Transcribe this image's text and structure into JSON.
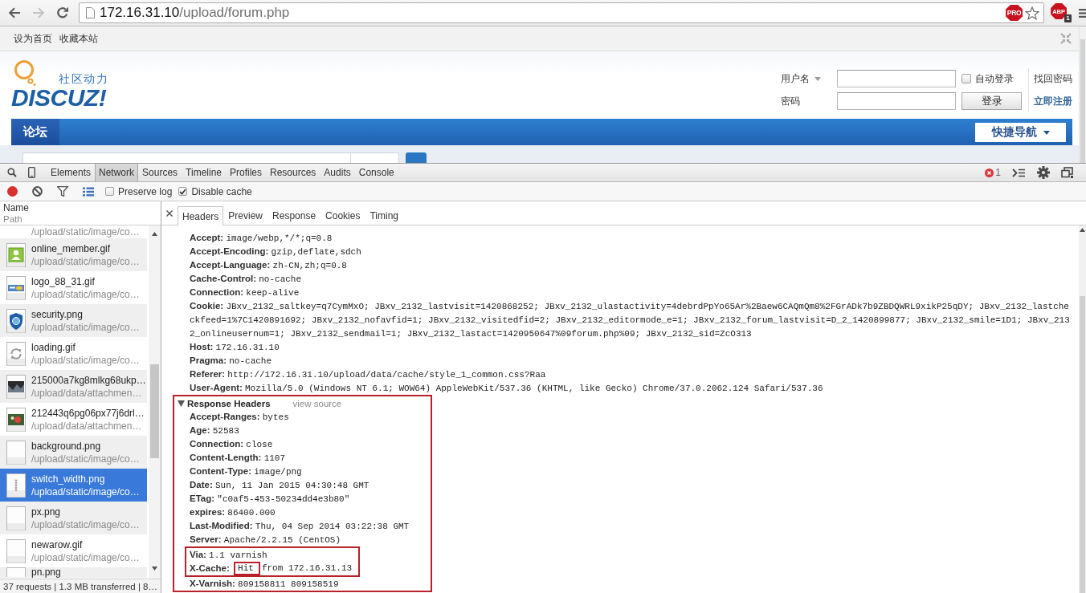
{
  "toolbar": {
    "back": {
      "disabled": false
    },
    "forward": {
      "disabled": true
    }
  },
  "address_bar": {
    "host": "172.16.31.10",
    "path": "/upload/forum.php",
    "badge": "PRO"
  },
  "extension": {
    "label": "ABP",
    "badge": "1"
  },
  "site": {
    "top_links": [
      "设为首页",
      "收藏本站"
    ],
    "logo": {
      "tagline": "社区动力",
      "wordmark": "DISCUZ!"
    },
    "login": {
      "username_label": "用户名",
      "password_label": "密码",
      "remember": {
        "label": "自动登录",
        "checked": false
      },
      "forgot_link": "找回密码",
      "submit": "登录",
      "register_link": "立即注册"
    },
    "nav": {
      "items": [
        {
          "label": "论坛",
          "selected": true
        }
      ],
      "quick_nav": "快捷导航"
    }
  },
  "devtools": {
    "panels": [
      {
        "label": "Elements",
        "selected": false
      },
      {
        "label": "Network",
        "selected": true
      },
      {
        "label": "Sources",
        "selected": false
      },
      {
        "label": "Timeline",
        "selected": false
      },
      {
        "label": "Profiles",
        "selected": false
      },
      {
        "label": "Resources",
        "selected": false
      },
      {
        "label": "Audits",
        "selected": false
      },
      {
        "label": "Console",
        "selected": false
      }
    ],
    "error_count": "1",
    "network": {
      "recording": true,
      "preserve_log": {
        "label": "Preserve log",
        "checked": false
      },
      "disable_cache": {
        "label": "Disable cache",
        "checked": true
      },
      "column": {
        "title": "Name",
        "subtitle": "Path"
      },
      "requests": [
        {
          "path": "/upload/static/image/co…",
          "selected": false
        },
        {
          "kind": "person",
          "name": "online_member.gif",
          "path": "/upload/static/image/co…",
          "selected": false
        },
        {
          "kind": "banner",
          "name": "logo_88_31.gif",
          "path": "/upload/static/image/co…",
          "selected": false
        },
        {
          "kind": "shield",
          "name": "security.png",
          "path": "/upload/static/image/co…",
          "selected": false
        },
        {
          "kind": "refresh",
          "name": "loading.gif",
          "path": "/upload/static/image/co…",
          "selected": false
        },
        {
          "kind": "photo",
          "name": "215000a7kg8mlkg68ukp…",
          "path": "/upload/data/attachmen…",
          "selected": false
        },
        {
          "kind": "picture",
          "name": "212443q6pg06px77j6drl…",
          "path": "/upload/data/attachmen…",
          "selected": false
        },
        {
          "kind": "blank",
          "name": "background.png",
          "path": "/upload/static/image/co…",
          "selected": false
        },
        {
          "kind": "grip",
          "name": "switch_width.png",
          "path": "/upload/static/image/co…",
          "selected": true
        },
        {
          "kind": "blank",
          "name": "px.png",
          "path": "/upload/static/image/co…",
          "selected": false
        },
        {
          "kind": "blank",
          "name": "newarow.gif",
          "path": "/upload/static/image/co…",
          "selected": false
        },
        {
          "kind": "blank",
          "name": "pn.png",
          "selected": false
        }
      ],
      "summary": "37 requests | 1.3 MB transferred | 8…"
    },
    "detail": {
      "tabs": [
        {
          "label": "Headers",
          "selected": true
        },
        {
          "label": "Preview",
          "selected": false
        },
        {
          "label": "Response",
          "selected": false
        },
        {
          "label": "Cookies",
          "selected": false
        },
        {
          "label": "Timing",
          "selected": false
        }
      ],
      "request_headers": [
        {
          "key": "Accept:",
          "value": "image/webp,*/*;q=0.8"
        },
        {
          "key": "Accept-Encoding:",
          "value": "gzip,deflate,sdch"
        },
        {
          "key": "Accept-Language:",
          "value": "zh-CN,zh;q=0.8"
        },
        {
          "key": "Cache-Control:",
          "value": "no-cache"
        },
        {
          "key": "Connection:",
          "value": "keep-alive"
        },
        {
          "key": "Cookie:",
          "value": "JBxv_2132_saltkey=q7CymMxO; JBxv_2132_lastvisit=1420868252; JBxv_2132_ulastactivity=4debrdPpYo65Ar%2Baew6CAQmQm8%2FGrADk7b9ZBDQWRL9xikP25qDY; JBxv_2132_lastcheckfeed=1%7C1420891692; JBxv_2132_nofavfid=1; JBxv_2132_visitedfid=2; JBxv_2132_editormode_e=1; JBxv_2132_forum_lastvisit=D_2_1420899877; JBxv_2132_smile=1D1; JBxv_2132_onlineusernum=1; JBxv_2132_sendmail=1; JBxv_2132_lastact=1420950647%09forum.php%09; JBxv_2132_sid=ZcO313"
        },
        {
          "key": "Host:",
          "value": "172.16.31.10"
        },
        {
          "key": "Pragma:",
          "value": "no-cache"
        },
        {
          "key": "Referer:",
          "value": "http://172.16.31.10/upload/data/cache/style_1_common.css?Raa"
        },
        {
          "key": "User-Agent:",
          "value": "Mozilla/5.0 (Windows NT 6.1; WOW64) AppleWebKit/537.36 (KHTML, like Gecko) Chrome/37.0.2062.124 Safari/537.36"
        }
      ],
      "response_headers": {
        "title": "Response Headers",
        "link": "view source",
        "expanded": true,
        "highlighted": true,
        "entries": [
          {
            "kind": "line",
            "key": "Accept-Ranges:",
            "value": "bytes"
          },
          {
            "kind": "line",
            "key": "Age:",
            "value": "52583"
          },
          {
            "kind": "line",
            "key": "Connection:",
            "value": "close"
          },
          {
            "kind": "line",
            "key": "Content-Length:",
            "value": "1107"
          },
          {
            "kind": "line",
            "key": "Content-Type:",
            "value": "image/png"
          },
          {
            "kind": "line",
            "key": "Date:",
            "value": "Sun, 11 Jan 2015 04:30:48 GMT"
          },
          {
            "kind": "line",
            "key": "ETag:",
            "value": "\"c0af5-453-50234dd4e3b80\""
          },
          {
            "kind": "line",
            "key": "expires:",
            "value": "86400.000"
          },
          {
            "kind": "line",
            "key": "Last-Modified:",
            "value": "Thu, 04 Sep 2014 03:22:38 GMT"
          },
          {
            "kind": "line",
            "key": "Server:",
            "value": "Apache/2.2.15 (CentOS)"
          },
          {
            "kind": "group",
            "highlighted": true,
            "entries": [
              {
                "kind": "line",
                "key": "Via:",
                "value": "1.1 varnish"
              },
              {
                "kind": "split",
                "key": "X-Cache:",
                "parts": [
                  {
                    "text": "Hit",
                    "highlighted": true
                  },
                  {
                    "text": "from 172.16.31.13",
                    "highlighted": false
                  }
                ]
              }
            ]
          },
          {
            "kind": "line",
            "key": "X-Varnish:",
            "value": "809158811 809158519"
          }
        ]
      }
    }
  }
}
